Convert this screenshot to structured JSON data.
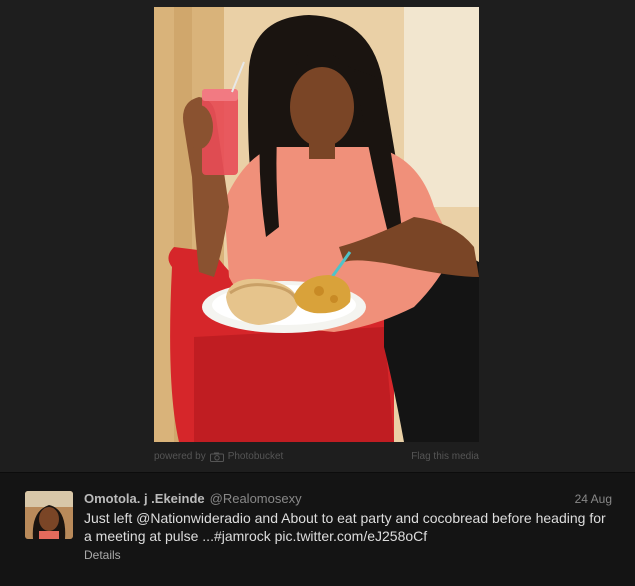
{
  "media": {
    "powered_by": "powered by",
    "provider": "Photobucket",
    "flag_label": "Flag this media"
  },
  "tweet": {
    "fullname": "Omotola. j .Ekeinde",
    "username": "@Realomosexy",
    "timestamp": "24 Aug",
    "text": "Just left @Nationwideradio and About to eat party and cocobread before heading for a meeting at pulse ...#jamrock pic.twitter.com/eJ258oCf",
    "details_label": "Details"
  },
  "colors": {
    "background": "#1c1c1c",
    "panel": "#141414",
    "name": "#bbbbbb",
    "text": "#dddddd"
  }
}
